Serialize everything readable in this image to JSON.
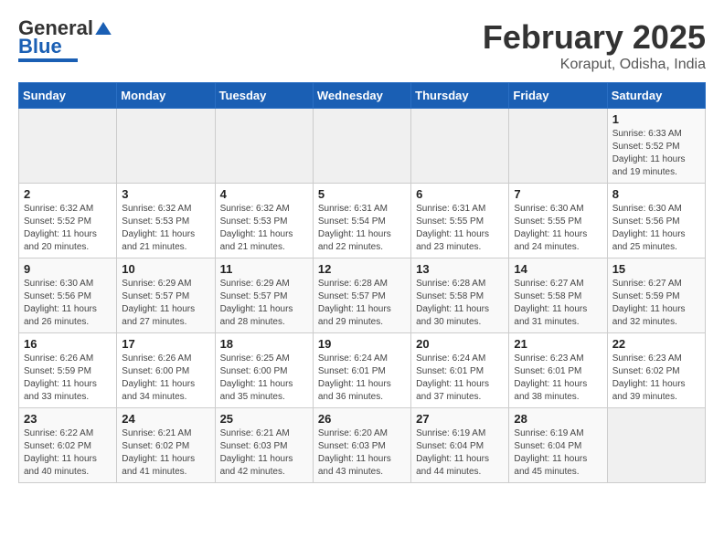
{
  "header": {
    "logo_line1": "General",
    "logo_line2": "Blue",
    "month_title": "February 2025",
    "location": "Koraput, Odisha, India"
  },
  "days_of_week": [
    "Sunday",
    "Monday",
    "Tuesday",
    "Wednesday",
    "Thursday",
    "Friday",
    "Saturday"
  ],
  "weeks": [
    [
      {
        "day": "",
        "info": ""
      },
      {
        "day": "",
        "info": ""
      },
      {
        "day": "",
        "info": ""
      },
      {
        "day": "",
        "info": ""
      },
      {
        "day": "",
        "info": ""
      },
      {
        "day": "",
        "info": ""
      },
      {
        "day": "1",
        "info": "Sunrise: 6:33 AM\nSunset: 5:52 PM\nDaylight: 11 hours and 19 minutes."
      }
    ],
    [
      {
        "day": "2",
        "info": "Sunrise: 6:32 AM\nSunset: 5:52 PM\nDaylight: 11 hours and 20 minutes."
      },
      {
        "day": "3",
        "info": "Sunrise: 6:32 AM\nSunset: 5:53 PM\nDaylight: 11 hours and 21 minutes."
      },
      {
        "day": "4",
        "info": "Sunrise: 6:32 AM\nSunset: 5:53 PM\nDaylight: 11 hours and 21 minutes."
      },
      {
        "day": "5",
        "info": "Sunrise: 6:31 AM\nSunset: 5:54 PM\nDaylight: 11 hours and 22 minutes."
      },
      {
        "day": "6",
        "info": "Sunrise: 6:31 AM\nSunset: 5:55 PM\nDaylight: 11 hours and 23 minutes."
      },
      {
        "day": "7",
        "info": "Sunrise: 6:30 AM\nSunset: 5:55 PM\nDaylight: 11 hours and 24 minutes."
      },
      {
        "day": "8",
        "info": "Sunrise: 6:30 AM\nSunset: 5:56 PM\nDaylight: 11 hours and 25 minutes."
      }
    ],
    [
      {
        "day": "9",
        "info": "Sunrise: 6:30 AM\nSunset: 5:56 PM\nDaylight: 11 hours and 26 minutes."
      },
      {
        "day": "10",
        "info": "Sunrise: 6:29 AM\nSunset: 5:57 PM\nDaylight: 11 hours and 27 minutes."
      },
      {
        "day": "11",
        "info": "Sunrise: 6:29 AM\nSunset: 5:57 PM\nDaylight: 11 hours and 28 minutes."
      },
      {
        "day": "12",
        "info": "Sunrise: 6:28 AM\nSunset: 5:57 PM\nDaylight: 11 hours and 29 minutes."
      },
      {
        "day": "13",
        "info": "Sunrise: 6:28 AM\nSunset: 5:58 PM\nDaylight: 11 hours and 30 minutes."
      },
      {
        "day": "14",
        "info": "Sunrise: 6:27 AM\nSunset: 5:58 PM\nDaylight: 11 hours and 31 minutes."
      },
      {
        "day": "15",
        "info": "Sunrise: 6:27 AM\nSunset: 5:59 PM\nDaylight: 11 hours and 32 minutes."
      }
    ],
    [
      {
        "day": "16",
        "info": "Sunrise: 6:26 AM\nSunset: 5:59 PM\nDaylight: 11 hours and 33 minutes."
      },
      {
        "day": "17",
        "info": "Sunrise: 6:26 AM\nSunset: 6:00 PM\nDaylight: 11 hours and 34 minutes."
      },
      {
        "day": "18",
        "info": "Sunrise: 6:25 AM\nSunset: 6:00 PM\nDaylight: 11 hours and 35 minutes."
      },
      {
        "day": "19",
        "info": "Sunrise: 6:24 AM\nSunset: 6:01 PM\nDaylight: 11 hours and 36 minutes."
      },
      {
        "day": "20",
        "info": "Sunrise: 6:24 AM\nSunset: 6:01 PM\nDaylight: 11 hours and 37 minutes."
      },
      {
        "day": "21",
        "info": "Sunrise: 6:23 AM\nSunset: 6:01 PM\nDaylight: 11 hours and 38 minutes."
      },
      {
        "day": "22",
        "info": "Sunrise: 6:23 AM\nSunset: 6:02 PM\nDaylight: 11 hours and 39 minutes."
      }
    ],
    [
      {
        "day": "23",
        "info": "Sunrise: 6:22 AM\nSunset: 6:02 PM\nDaylight: 11 hours and 40 minutes."
      },
      {
        "day": "24",
        "info": "Sunrise: 6:21 AM\nSunset: 6:02 PM\nDaylight: 11 hours and 41 minutes."
      },
      {
        "day": "25",
        "info": "Sunrise: 6:21 AM\nSunset: 6:03 PM\nDaylight: 11 hours and 42 minutes."
      },
      {
        "day": "26",
        "info": "Sunrise: 6:20 AM\nSunset: 6:03 PM\nDaylight: 11 hours and 43 minutes."
      },
      {
        "day": "27",
        "info": "Sunrise: 6:19 AM\nSunset: 6:04 PM\nDaylight: 11 hours and 44 minutes."
      },
      {
        "day": "28",
        "info": "Sunrise: 6:19 AM\nSunset: 6:04 PM\nDaylight: 11 hours and 45 minutes."
      },
      {
        "day": "",
        "info": ""
      }
    ]
  ]
}
